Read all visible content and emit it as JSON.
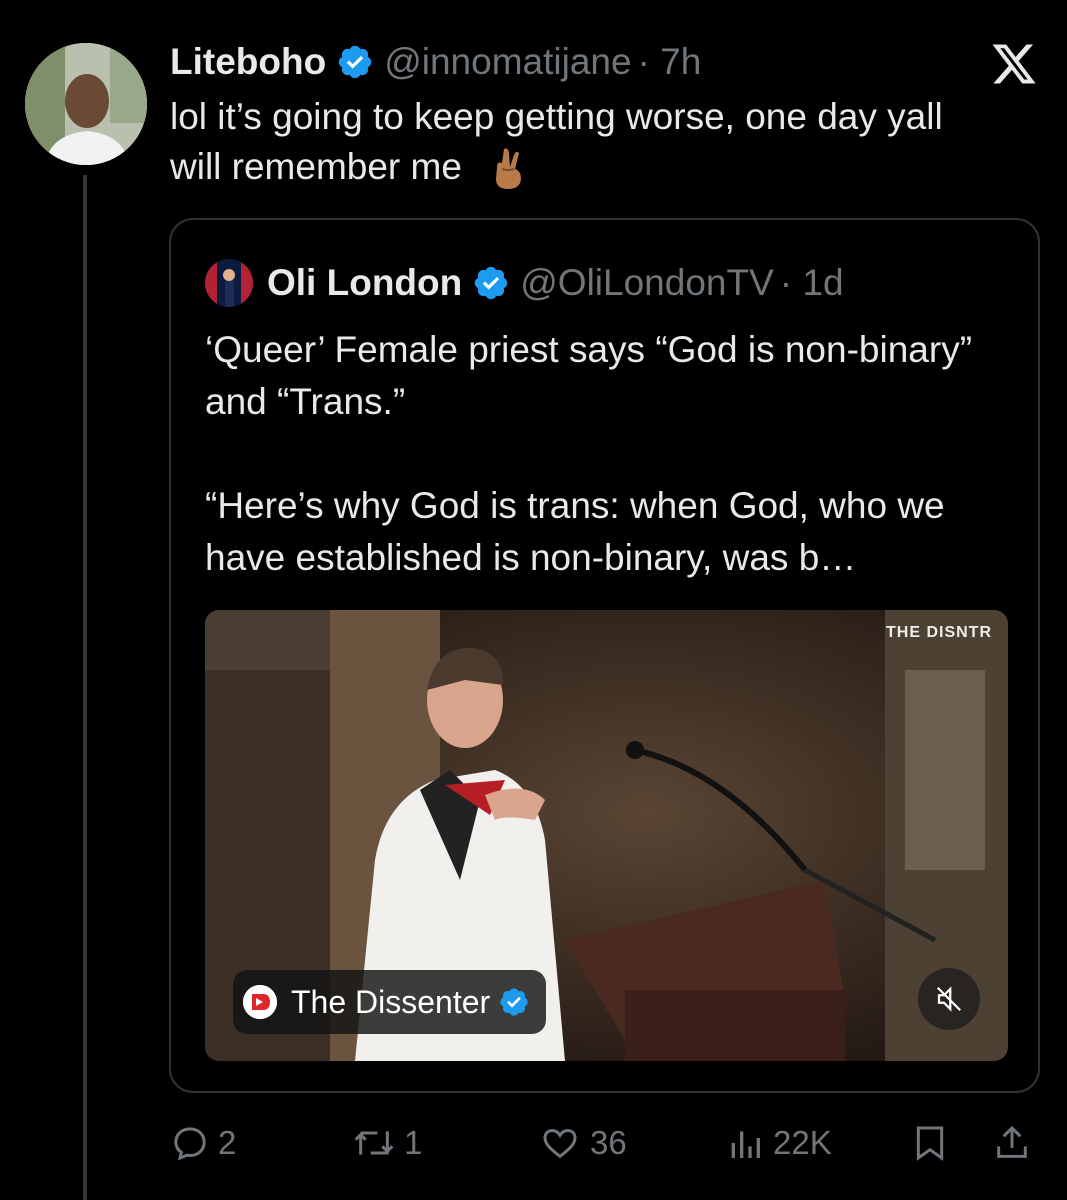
{
  "tweet": {
    "author_name": "Liteboho",
    "author_handle": "@innomatijane",
    "time": "· 7h",
    "text_line1": "lol it’s going to keep getting worse, one day yall",
    "text_line2": "will remember me",
    "emoji": "crossed-fingers-emoji"
  },
  "quote": {
    "author_name": "Oli London",
    "author_handle": "@OliLondonTV",
    "time": "· 1d",
    "para1": "‘Queer’ Female priest says “God is non-binary” and  “Trans.”",
    "para2": "“Here’s why God is trans: when God, who we have established is non-binary, was b…",
    "video": {
      "watermark": "THE DISNTR",
      "source_label": "The Dissenter",
      "mute_icon": "muted-speaker-icon"
    }
  },
  "actions": {
    "replies": "2",
    "reposts": "1",
    "likes": "36",
    "views": "22K"
  },
  "colors": {
    "background": "#000000",
    "text": "#e7e9ea",
    "muted": "#71767b",
    "verified": "#1d9bf0",
    "border": "#2f3336"
  }
}
